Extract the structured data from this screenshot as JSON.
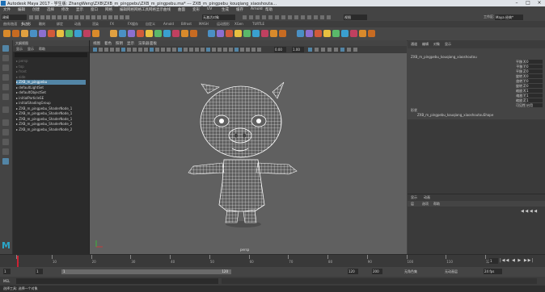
{
  "window": {
    "title": "Autodesk Maya 2017 - 学生版: ZhangWeng\\ZXB\\ZXB_m_pingpebu\\ZXB_m_pingpebu.ma* --- ZXB_m_pingpebu_kouqiang_xiaoshouta..."
  },
  "menubar": [
    "文件",
    "编辑",
    "创建",
    "选择",
    "修改",
    "显示",
    "窗口",
    "网格",
    "编辑网格",
    "网格工具",
    "网格显示",
    "曲线",
    "曲面",
    "变形",
    "UV",
    "生成",
    "缓存",
    "Arnold",
    "帮助"
  ],
  "status": {
    "mode": "建模",
    "search_placeholder": "无激活对象",
    "workspace_label": "工作区:",
    "workspace_value": "Maya 经典*"
  },
  "shelf_tabs": [
    "曲线/曲面",
    "多边形",
    "雕刻",
    "绑定",
    "动画",
    "渲染",
    "FX",
    "FX缓存",
    "自定义",
    "Arnold",
    "Bifrost",
    "MASH",
    "运动图形",
    "XGen",
    "TURTLE"
  ],
  "outliner": {
    "title": "大纲视图",
    "menu": [
      "显示",
      "显示",
      "帮助"
    ],
    "items": [
      {
        "label": "persp",
        "dim": true
      },
      {
        "label": "top",
        "dim": true
      },
      {
        "label": "front",
        "dim": true
      },
      {
        "label": "side",
        "dim": true
      },
      {
        "label": "ZXB_m_pingpebu",
        "dim": false,
        "selected": true
      },
      {
        "label": "defaultLightSet",
        "dim": false
      },
      {
        "label": "defaultObjectSet",
        "dim": false
      },
      {
        "label": "initialParticleSE",
        "dim": false
      },
      {
        "label": "initialShadingGroup",
        "dim": false
      },
      {
        "label": "ZXB_m_pingpebu_ShaderNode_1",
        "dim": false
      },
      {
        "label": "ZXB_m_pingpebu_ShaderNode_1",
        "dim": false
      },
      {
        "label": "ZXB_m_pingpebu_ShaderNode_1",
        "dim": false
      },
      {
        "label": "ZXB_m_pingpebu_ShaderNode_2",
        "dim": false
      },
      {
        "label": "ZXB_m_pingpebu_ShaderNode_2",
        "dim": false
      }
    ]
  },
  "viewport": {
    "menu": [
      "视图",
      "着色",
      "照明",
      "显示",
      "渲染器",
      "面板"
    ],
    "camera": "persp",
    "field1": "0.00",
    "field2": "1.00"
  },
  "channel_box": {
    "menu": [
      "通道",
      "编辑",
      "对象",
      "显示"
    ],
    "object": "ZXB_m_pingpebu_kouqiang_xiaoshoutou",
    "attributes": [
      {
        "name": "平移 X",
        "value": "0"
      },
      {
        "name": "平移 Y",
        "value": "0"
      },
      {
        "name": "平移 Z",
        "value": "0"
      },
      {
        "name": "旋转 X",
        "value": "0"
      },
      {
        "name": "旋转 Y",
        "value": "0"
      },
      {
        "name": "旋转 Z",
        "value": "0"
      },
      {
        "name": "缩放 X",
        "value": "1"
      },
      {
        "name": "缩放 Y",
        "value": "1"
      },
      {
        "name": "缩放 Z",
        "value": "1"
      },
      {
        "name": "可见性",
        "value": "启用"
      }
    ],
    "shapes_label": "形状",
    "shape_name": "ZXB_m_pingpebu_kouqiang_xiaoshoutouShape"
  },
  "layer_editor": {
    "tabs": [
      "显示",
      "动画"
    ],
    "menu": [
      "层",
      "选项",
      "帮助"
    ]
  },
  "timeline": {
    "ticks": [
      "1",
      "10",
      "20",
      "30",
      "40",
      "50",
      "60",
      "70",
      "80",
      "90",
      "100",
      "110",
      "120"
    ],
    "current_frame": "1"
  },
  "range": {
    "start": "1",
    "inner_start": "1",
    "inner_end": "120",
    "end": "120",
    "end2": "200",
    "charset": "无角色集",
    "animlayer": "无动画层",
    "fps": "24 fps"
  },
  "cmdline": {
    "label": "MEL"
  },
  "helpline": {
    "text": "选择工具: 选择一个对象"
  },
  "colors": {
    "accent": "#5285a6",
    "viewport_bg": "#606060",
    "wire": "#ffffff"
  }
}
